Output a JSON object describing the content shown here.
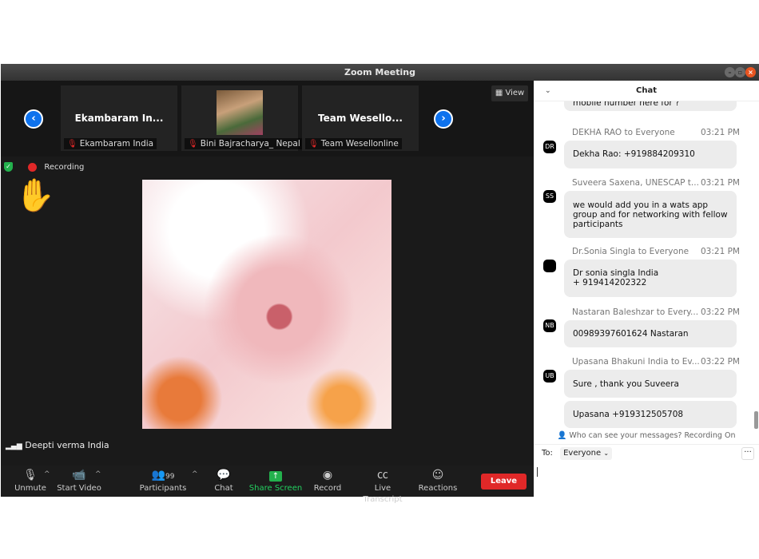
{
  "window": {
    "title": "Zoom Meeting"
  },
  "strip": {
    "tiles": [
      {
        "name": "Ekambaram In...",
        "label": "Ekambaram India"
      },
      {
        "name": "",
        "label": "Bini Bajracharya_ Nepal"
      },
      {
        "name": "Team Wesello...",
        "label": "Team Wesellonline"
      }
    ],
    "view_label": "View"
  },
  "status": {
    "recording_label": "Recording"
  },
  "active_speaker": "Deepti verma India",
  "toolbar": {
    "unmute": "Unmute",
    "start_video": "Start Video",
    "participants": "Participants",
    "participants_count": "99",
    "chat": "Chat",
    "share_screen": "Share Screen",
    "record": "Record",
    "live_transcript": "Live Transcript",
    "reactions": "Reactions",
    "leave": "Leave"
  },
  "chat": {
    "title": "Chat",
    "partial_top": "mobile number here for ?",
    "messages": [
      {
        "initials": "DR",
        "from": "DEKHA RAO to Everyone",
        "time": "03:21 PM",
        "lines": [
          "Dekha Rao: +919884209310"
        ]
      },
      {
        "initials": "SS",
        "from": "Suveera Saxena, UNESCAP t...",
        "time": "03:21 PM",
        "lines": [
          "we would add you in a wats app",
          "group and for networking with fellow",
          "participants"
        ]
      },
      {
        "initials": "",
        "from": "Dr.Sonia Singla to Everyone",
        "time": "03:21 PM",
        "lines": [
          "Dr sonia singla India",
          "+ 919414202322"
        ]
      },
      {
        "initials": "NB",
        "from": "Nastaran Baleshzar to Every...",
        "time": "03:22 PM",
        "lines": [
          "00989397601624 Nastaran"
        ]
      },
      {
        "initials": "UB",
        "from": "Upasana Bhakuni India to Ev...",
        "time": "03:22 PM",
        "lines": [
          "Sure , thank you Suveera"
        ]
      }
    ],
    "extra_message": "Upasana +919312505708",
    "notice": "Who can see your messages? Recording On",
    "to_label": "To:",
    "to_value": "Everyone"
  }
}
